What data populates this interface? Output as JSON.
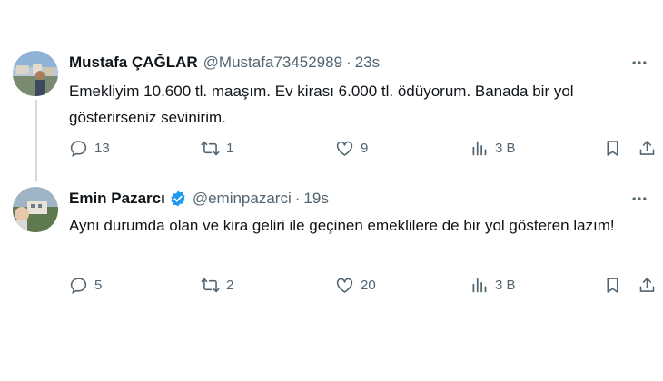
{
  "tweets": [
    {
      "name": "Mustafa ÇAĞLAR",
      "verified": false,
      "handle": "@Mustafa73452989",
      "separator": "·",
      "time": "23s",
      "text": "Emekliyim 10.600 tl. maaşım. Ev kirası 6.000 tl. ödüyorum. Banada bir yol gösterirseniz sevinirim.",
      "replies": "13",
      "retweets": "1",
      "likes": "9",
      "views": "3 B"
    },
    {
      "name": "Emin Pazarcı",
      "verified": true,
      "handle": "@eminpazarci",
      "separator": "·",
      "time": "19s",
      "text": "Aynı durumda olan ve kira geliri ile geçinen emeklilere de bir yol gösteren lazım!",
      "replies": "5",
      "retweets": "2",
      "likes": "20",
      "views": "3 B"
    }
  ],
  "colors": {
    "text": "#0f1419",
    "secondary": "#536471",
    "verified": "#1d9bf0",
    "thread_line": "#cfd9de"
  },
  "icons": [
    "more-icon",
    "reply-icon",
    "retweet-icon",
    "like-icon",
    "views-icon",
    "bookmark-icon",
    "share-icon",
    "verified-badge-icon"
  ]
}
